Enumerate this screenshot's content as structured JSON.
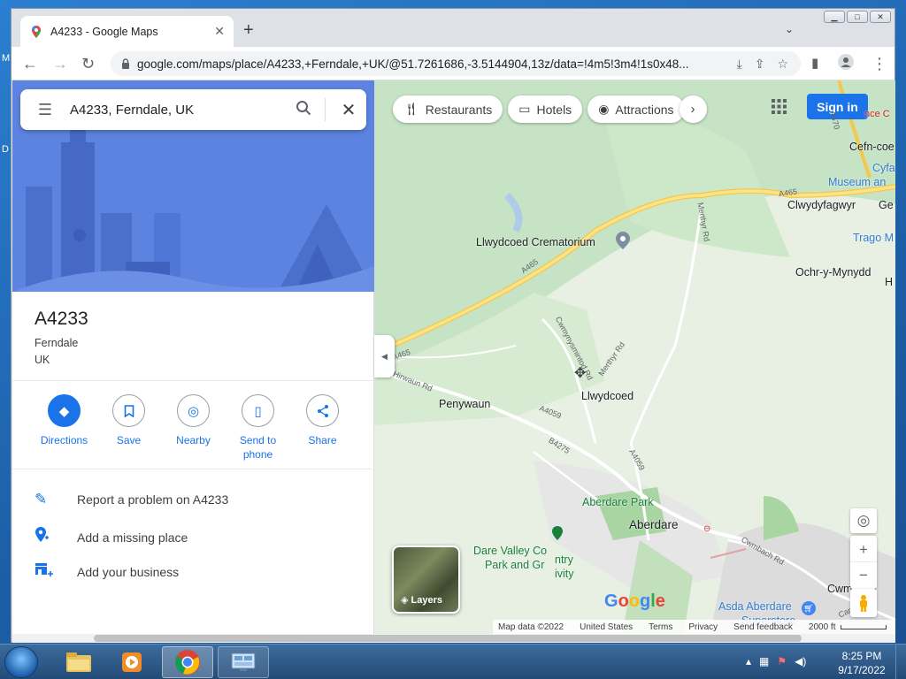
{
  "desktop": {
    "frag1": "M",
    "frag2": "D"
  },
  "browser": {
    "tab_title": "A4233 - Google Maps",
    "url": "google.com/maps/place/A4233,+Ferndale,+UK/@51.7261686,-3.5144904,13z/data=!4m5!3m4!1s0x48..."
  },
  "search": {
    "query": "A4233, Ferndale, UK"
  },
  "place": {
    "name": "A4233",
    "locality": "Ferndale",
    "country": "UK"
  },
  "actions": [
    {
      "label": "Directions",
      "icon": "directions-icon"
    },
    {
      "label": "Save",
      "icon": "bookmark-icon"
    },
    {
      "label": "Nearby",
      "icon": "nearby-icon"
    },
    {
      "label": "Send to phone",
      "icon": "phone-icon"
    },
    {
      "label": "Share",
      "icon": "share-icon"
    }
  ],
  "links": [
    {
      "label": "Report a problem on A4233",
      "icon": "pencil-icon"
    },
    {
      "label": "Add a missing place",
      "icon": "add-place-icon"
    },
    {
      "label": "Add your business",
      "icon": "add-business-icon"
    }
  ],
  "chips": [
    {
      "label": "Restaurants",
      "icon": "fork-knife-icon"
    },
    {
      "label": "Hotels",
      "icon": "bed-icon"
    },
    {
      "label": "Attractions",
      "icon": "camera-icon"
    }
  ],
  "signin": "Sign in",
  "map_labels": {
    "crematorium": "Llwydcoed Crematorium",
    "penywaun": "Penywaun",
    "llwydcoed": "Llwydcoed",
    "aberdare_park": "Aberdare Park",
    "aberdare": "Aberdare",
    "dare_valley_1": "Dare Valley Co",
    "dare_valley_2": "Park and Gr",
    "dare_valley_frag1": "ntry",
    "dare_valley_frag2": "ivity",
    "clwydyfagwyr": "Clwydyfagwyr",
    "ge": "Ge",
    "ochr": "Ochr-y-Mynydd",
    "h": "H",
    "cefn": "Cefn-coe",
    "cyfa": "Cyfa",
    "museum": "Museum an",
    "trago": "Trago M",
    "nce": "nce C",
    "cwmbach": "Cwmbach",
    "asda": "Asda Aberdare",
    "asda2": "Superstore",
    "road_a465_1": "A465",
    "road_a465_2": "A465",
    "road_a465_3": "A465",
    "road_hirwaun": "Hirwaun Rd",
    "road_a4059_1": "A4059",
    "road_a4059_2": "A4059",
    "road_b4275": "B4275",
    "road_merthyr_1": "Merthyr Rd",
    "road_merthyr_2": "Merthyr Rd",
    "road_cwmynys": "Cwmynysmintod Rd",
    "road_cwmbach": "Cwmbach Rd",
    "road_a470": "A470",
    "road_canal": "Canal"
  },
  "layers_label": "Layers",
  "google_logo": "Google",
  "footer": {
    "map_data": "Map data ©2022",
    "region": "United States",
    "terms": "Terms",
    "privacy": "Privacy",
    "feedback": "Send feedback",
    "scale": "2000 ft"
  },
  "taskbar": {
    "time": "8:25 PM",
    "date": "9/17/2022"
  },
  "colors": {
    "accent": "#1a73e8",
    "hero": "#5b83df",
    "map_bg": "#e8f0e4",
    "road_major": "#f9d56b"
  }
}
